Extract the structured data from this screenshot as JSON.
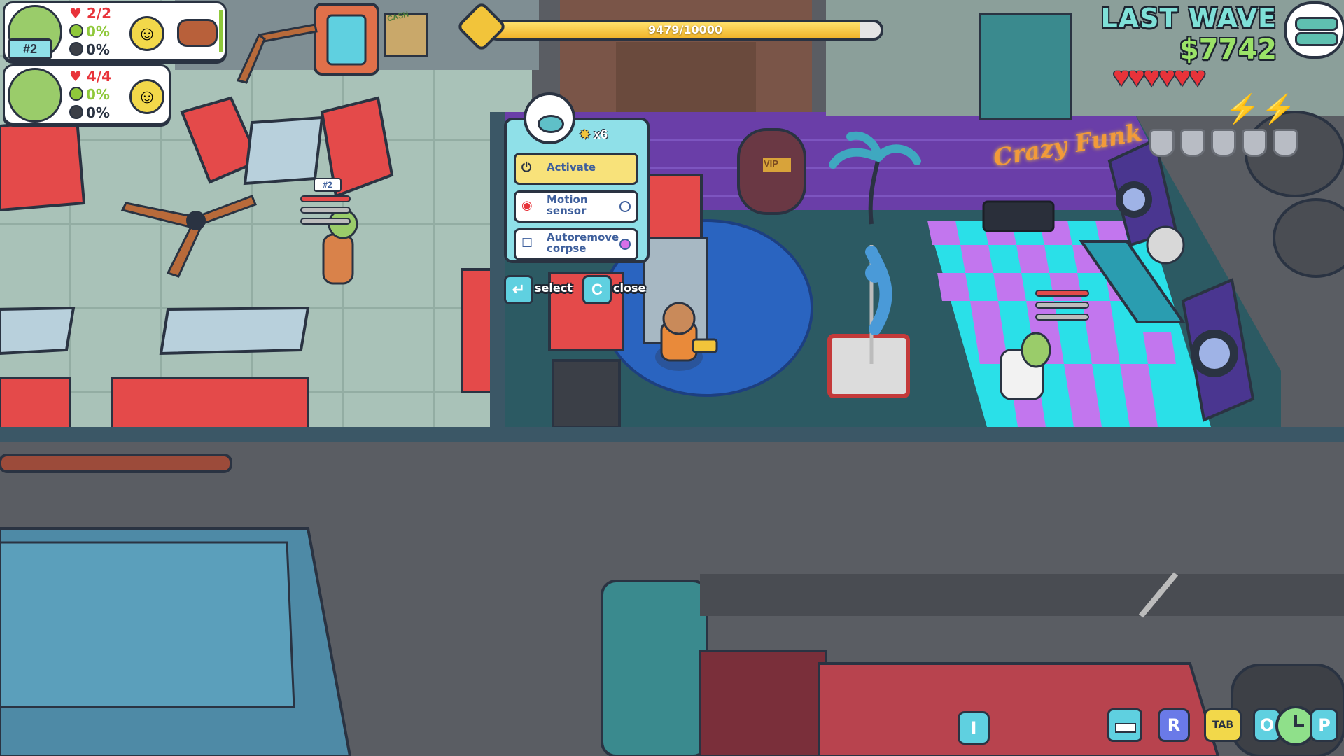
{
  "customers": [
    {
      "badge": "#2",
      "health": "2/2",
      "stat_a": "0%",
      "stat_b": "0%"
    },
    {
      "badge": "",
      "health": "4/4",
      "stat_a": "0%",
      "stat_b": "0%"
    }
  ],
  "wave": {
    "progress_text": "9479/10000",
    "progress_fraction": 0.9479,
    "label": "LAST WAVE"
  },
  "money": "$7742",
  "status": {
    "hearts": 6,
    "lightning": 2,
    "shields": 5
  },
  "popup": {
    "count": "x6",
    "options": [
      {
        "label": "Activate",
        "selected": true
      },
      {
        "label": "Motion sensor",
        "selected": false
      },
      {
        "label": "Autoremove corpse",
        "selected": false
      }
    ],
    "keys": [
      {
        "key": "↵",
        "label": "select"
      },
      {
        "key": "C",
        "label": "close"
      }
    ]
  },
  "world": {
    "enemy_badge": "#2",
    "neon_sign": "Crazy Funk",
    "vip_sign": "VIP",
    "cash_sign": "CASH"
  },
  "hotkeys": [
    {
      "key": "I"
    },
    {
      "key": "R"
    },
    {
      "key": "TAB"
    },
    {
      "key": "O"
    },
    {
      "key": "P"
    }
  ],
  "colors": {
    "accent": "#8fe0e8",
    "money": "#9be268",
    "wave": "#7fe0d8",
    "heart": "#e8333a",
    "bolt": "#e845c8"
  }
}
